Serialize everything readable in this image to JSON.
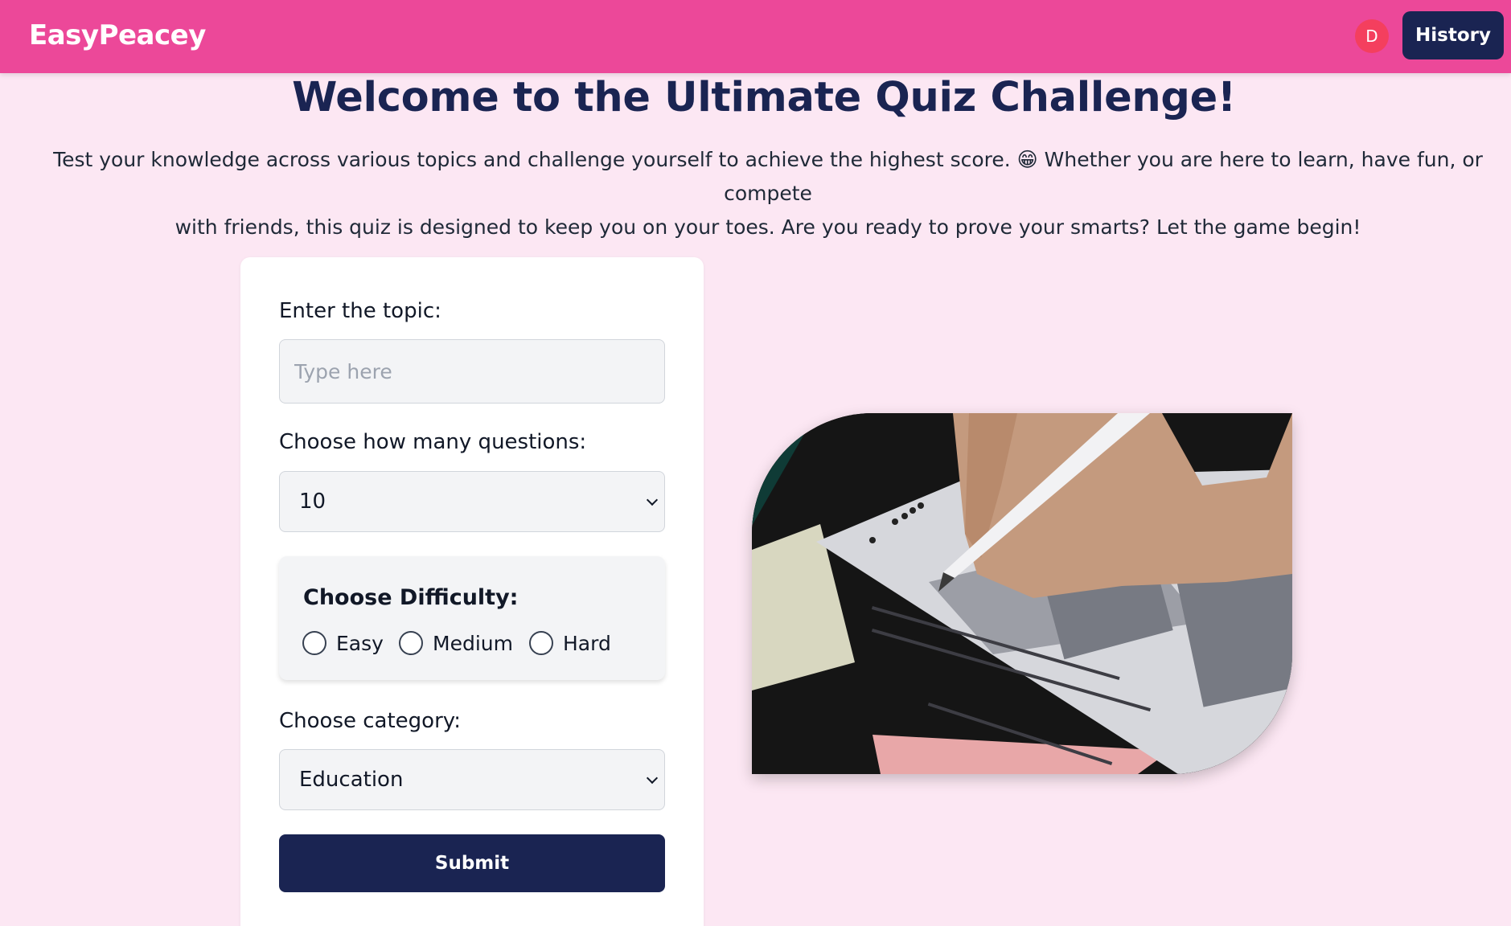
{
  "navbar": {
    "brand": "EasyPeacey",
    "avatar_initial": "D",
    "history_label": "History"
  },
  "hero": {
    "title": "Welcome to the Ultimate Quiz Challenge!",
    "intro_line1": "Test your knowledge across various topics and challenge yourself to achieve the highest score. 😁 Whether you are here to learn, have fun, or compete",
    "intro_line2": "with friends, this quiz is designed to keep you on your toes. Are you ready to prove your smarts? Let the game begin!"
  },
  "form": {
    "topic_label": "Enter the topic:",
    "topic_placeholder": "Type here",
    "topic_value": "",
    "count_label": "Choose how many questions:",
    "count_value": "10",
    "difficulty_title": "Choose Difficulty:",
    "difficulty_options": [
      "Easy",
      "Medium",
      "Hard"
    ],
    "category_label": "Choose category:",
    "category_value": "Education",
    "submit_label": "Submit"
  },
  "image": {
    "subject": "hand filling in a bubble answer sheet with a pencil"
  },
  "colors": {
    "navbar": "#ec4899",
    "page_bg": "#fce7f3",
    "primary_dark": "#1a2452",
    "avatar": "#f43f5e"
  }
}
